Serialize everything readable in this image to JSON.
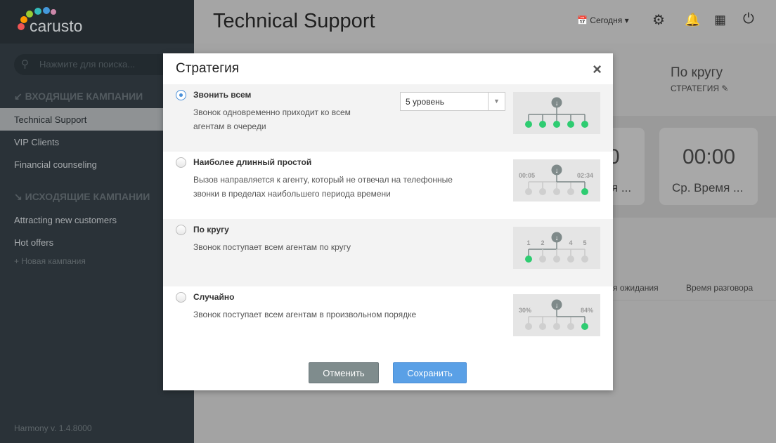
{
  "sidebar": {
    "logo": "carusto",
    "search_placeholder": "Нажмите для поиска...",
    "incoming_header": "ВХОДЯЩИЕ КАМПАНИИ",
    "incoming": [
      "Technical Support",
      "VIP Clients",
      "Financial counseling"
    ],
    "outgoing_header": "ИСХОДЯЩИЕ КАМПАНИИ",
    "outgoing": [
      "Attracting new customers",
      "Hot offers"
    ],
    "new_campaign": "+ Новая кампания",
    "version": "Harmony v. 1.4.8000"
  },
  "header": {
    "title": "Technical Support",
    "date": "Сегодня"
  },
  "background": {
    "strategy_value": "По кругу",
    "strategy_label": "СТРАТЕГИЯ",
    "card1_value": "0",
    "card1_label": "я ...",
    "card2_value": "00:00",
    "card2_label": "Ср. Время ...",
    "col1": "я ожидания",
    "col2": "Время разговора"
  },
  "modal": {
    "title": "Стратегия",
    "close": "×",
    "options": [
      {
        "title": "Звонить всем",
        "desc1": "Звонок одновременно приходит ко всем",
        "desc2": "агентам в очереди",
        "selected": true,
        "level": "5 уровень",
        "left": "",
        "right": "",
        "green": [
          1,
          1,
          1,
          1,
          1
        ]
      },
      {
        "title": "Наиболее длинный простой",
        "desc1": "Вызов направляется к агенту, который не отвечал на телефонные",
        "desc2": "звонки в пределах наибольшего периода времени",
        "selected": false,
        "left": "00:05",
        "right": "02:34",
        "green": [
          0,
          0,
          0,
          0,
          1
        ]
      },
      {
        "title": "По кругу",
        "desc1": "Звонок поступает всем агентам по кругу",
        "desc2": "",
        "selected": false,
        "labels": [
          "1",
          "2",
          "",
          "4",
          "5"
        ],
        "green": [
          1,
          0,
          0,
          0,
          0
        ]
      },
      {
        "title": "Случайно",
        "desc1": "Звонок поступает всем агентам в произвольном порядке",
        "desc2": "",
        "selected": false,
        "left": "30%",
        "right": "84%",
        "green": [
          0,
          0,
          0,
          0,
          1
        ]
      }
    ],
    "cancel": "Отменить",
    "save": "Сохранить"
  },
  "colors": {
    "green": "#2ecc71",
    "blue": "#5aa0e6",
    "grey_button": "#7f8c8d"
  }
}
